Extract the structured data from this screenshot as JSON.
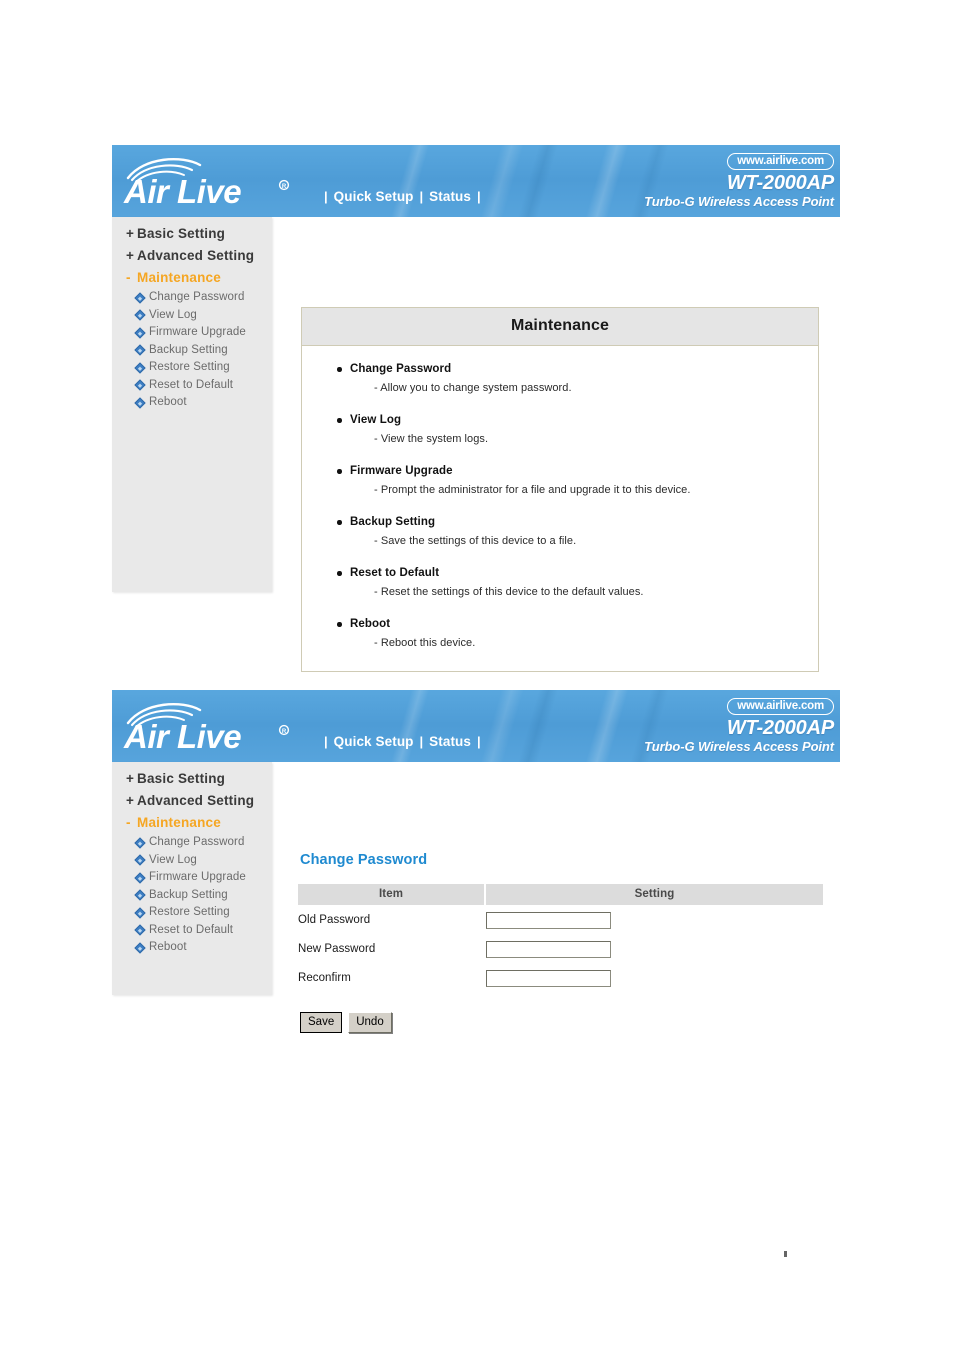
{
  "banner": {
    "logo_text": "Air Live",
    "logo_icon": "wifi-waves-icon",
    "registered_mark": "®",
    "nav": [
      {
        "label": "Quick Setup"
      },
      {
        "label": "Status"
      }
    ],
    "separator": "|",
    "url_pill": "www.airlive.com",
    "model": "WT-2000AP",
    "tagline": "Turbo-G Wireless Access Point",
    "bg_color": "#4e9cd6",
    "text_color": "#ffffff"
  },
  "sidebar": {
    "groups": [
      {
        "sign": "+",
        "label": "Basic Setting",
        "active": false
      },
      {
        "sign": "+",
        "label": "Advanced Setting",
        "active": false
      },
      {
        "sign": "-",
        "label": "Maintenance",
        "active": true
      }
    ],
    "items": [
      {
        "label": "Change Password"
      },
      {
        "label": "View Log"
      },
      {
        "label": "Firmware Upgrade"
      },
      {
        "label": "Backup Setting"
      },
      {
        "label": "Restore Setting"
      },
      {
        "label": "Reset to Default"
      },
      {
        "label": "Reboot"
      }
    ],
    "active_color": "#f5a623",
    "bg_color": "#e9e9e9"
  },
  "maintenance_panel": {
    "title": "Maintenance",
    "entries": [
      {
        "title": "Change Password",
        "desc": "- Allow you to change system password."
      },
      {
        "title": "View Log",
        "desc": "- View the system logs."
      },
      {
        "title": "Firmware Upgrade",
        "desc": "- Prompt the administrator for a file and upgrade it to this device."
      },
      {
        "title": "Backup Setting",
        "desc": "- Save the settings of this device to a file."
      },
      {
        "title": "Reset to Default",
        "desc": "- Reset the settings of this device to the default values."
      },
      {
        "title": "Reboot",
        "desc": "- Reboot this device."
      }
    ]
  },
  "password_form": {
    "title": "Change Password",
    "title_color": "#1f8ad0",
    "columns": {
      "item": "Item",
      "setting": "Setting"
    },
    "fields": [
      {
        "label": "Old Password",
        "value": ""
      },
      {
        "label": "New Password",
        "value": ""
      },
      {
        "label": "Reconfirm",
        "value": ""
      }
    ],
    "buttons": [
      {
        "label": "Save"
      },
      {
        "label": "Undo"
      }
    ]
  }
}
